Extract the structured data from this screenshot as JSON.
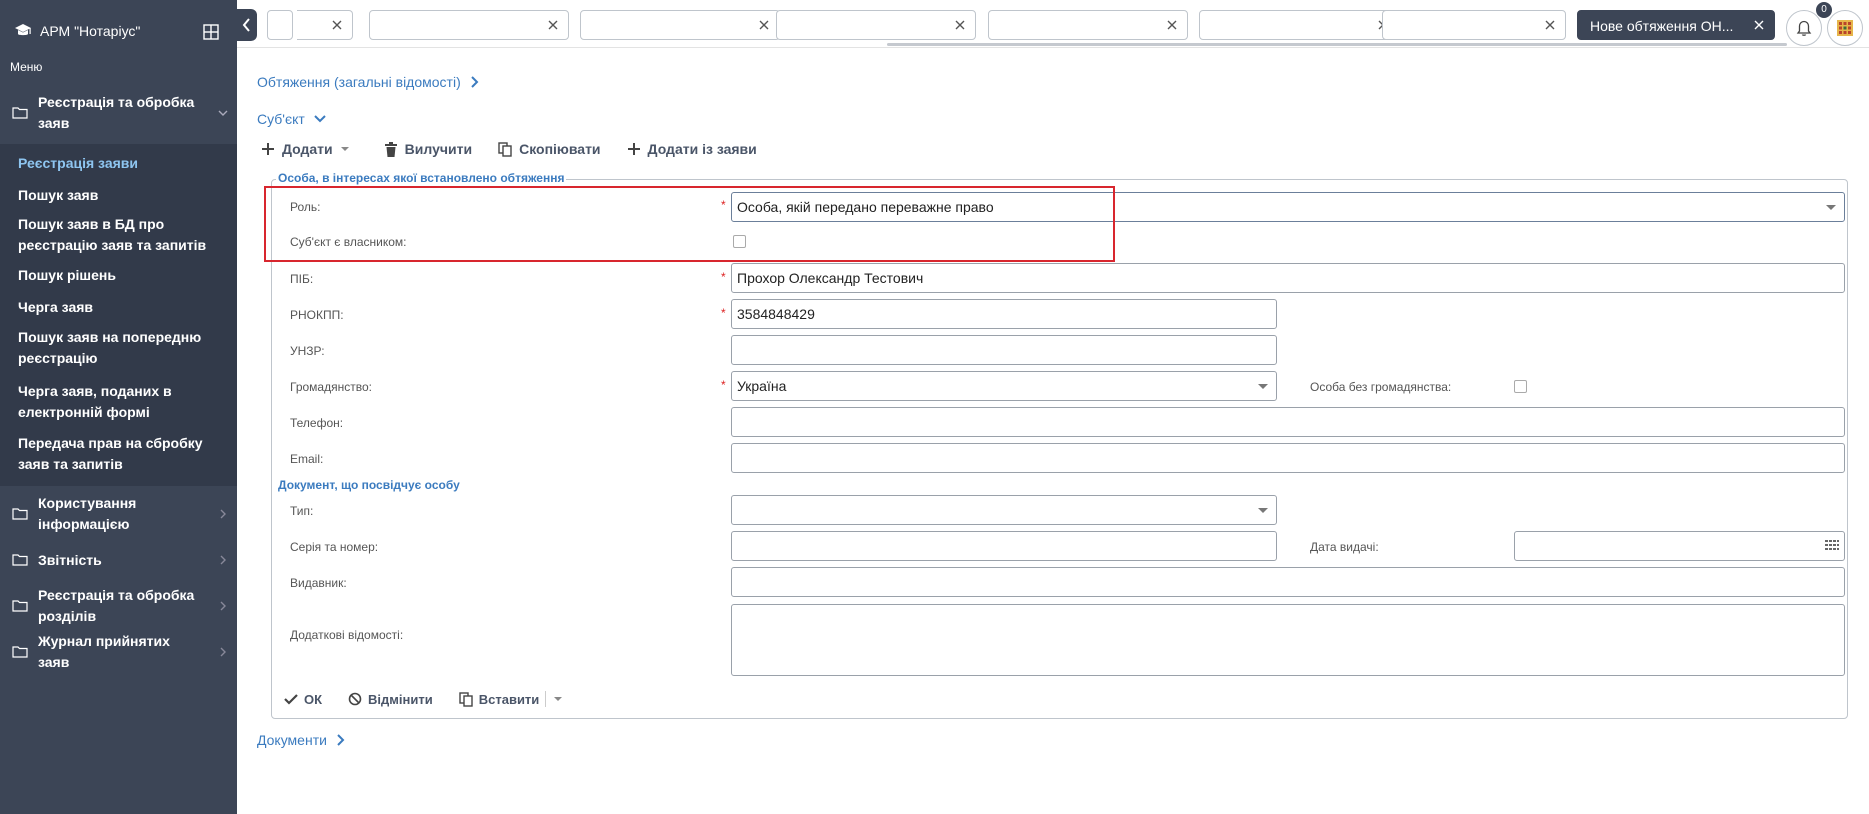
{
  "sidebar": {
    "app_title": "АРМ \"Нотаріус\"",
    "menu_label": "Меню",
    "groups": [
      {
        "label": "Реєстрація та обробка заяв",
        "items": [
          "Реєстрація заяви",
          "Пошук заяв",
          "Пошук заяв в БД про реєстрацію заяв та запитів",
          "Пошук рішень",
          "Черга заяв",
          "Пошук заяв на попередню реєстрацію",
          "Черга заяв, поданих в електронній формі",
          "Передача прав на сбробку заяв та запитів"
        ]
      },
      {
        "label": "Користування інформацією"
      },
      {
        "label": "Звітність"
      },
      {
        "label": "Реєстрація та обробка розділів"
      },
      {
        "label": "Журнал прийнятих заяв"
      }
    ]
  },
  "topbar": {
    "active_tab": "Нове обтяження ОН...",
    "notification_count": "0"
  },
  "sections": {
    "encumbrance": "Обтяження (загальні відомості)",
    "subject": "Суб'єкт",
    "documents": "Документи"
  },
  "toolbar": {
    "add": "Додати",
    "delete": "Вилучити",
    "copy": "Скопіювати",
    "add_from": "Додати із заяви"
  },
  "form": {
    "legend": "Особа, в інтересах якої встановлено обтяження",
    "role_label": "Роль:",
    "role_value": "Особа, якій передано переважне право",
    "owner_label": "Суб'єкт є власником:",
    "pib_label": "ПІБ:",
    "pib_value": "Прохор Олександр Тестович",
    "rnokpp_label": "РНОКПП:",
    "rnokpp_value": "3584848429",
    "unzr_label": "УНЗР:",
    "citizenship_label": "Громадянство:",
    "citizenship_value": "Україна",
    "stateless_label": "Особа без громадянства:",
    "phone_label": "Телефон:",
    "email_label": "Email:",
    "doc_heading": "Документ, що посвідчує особу",
    "type_label": "Тип:",
    "series_label": "Серія та номер:",
    "issue_date_label": "Дата видачі:",
    "issuer_label": "Видавник:",
    "extra_label": "Додаткові відомості:",
    "ok": "ОК",
    "cancel": "Відмінити",
    "paste": "Вставити"
  },
  "colors": {
    "sidebar_bg": "#3c4556",
    "link": "#3b7bbf",
    "highlight": "#d8262e"
  }
}
